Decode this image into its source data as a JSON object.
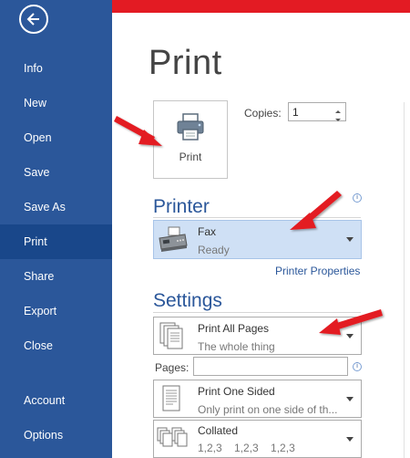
{
  "sidebar": {
    "items": [
      {
        "label": "Info"
      },
      {
        "label": "New"
      },
      {
        "label": "Open"
      },
      {
        "label": "Save"
      },
      {
        "label": "Save As"
      },
      {
        "label": "Print",
        "active": true
      },
      {
        "label": "Share"
      },
      {
        "label": "Export"
      },
      {
        "label": "Close"
      },
      {
        "label": "Account"
      },
      {
        "label": "Options"
      }
    ]
  },
  "main": {
    "title": "Print",
    "print_button_label": "Print",
    "copies_label": "Copies:",
    "copies_value": "1",
    "printer_heading": "Printer",
    "printer": {
      "name": "Fax",
      "status": "Ready"
    },
    "printer_properties_link": "Printer Properties",
    "settings_heading": "Settings",
    "print_range": {
      "title": "Print All Pages",
      "subtitle": "The whole thing"
    },
    "pages_label": "Pages:",
    "pages_value": "",
    "sides": {
      "title": "Print One Sided",
      "subtitle": "Only print on one side of th..."
    },
    "collation": {
      "title": "Collated",
      "subtitle": "1,2,3    1,2,3    1,2,3"
    }
  },
  "colors": {
    "sidebar": "#2b579a",
    "sidebar_active": "#19478a",
    "accent_strip": "#e31b23",
    "heading": "#2b579a",
    "printer_selected": "#cfe0f5",
    "annotation_arrow": "#e31b23"
  },
  "icons": [
    "back-arrow-icon",
    "printer-icon",
    "fax-machine-icon",
    "pages-icon",
    "one-sided-icon",
    "collated-icon",
    "info-icon",
    "chevron-down-icon"
  ]
}
